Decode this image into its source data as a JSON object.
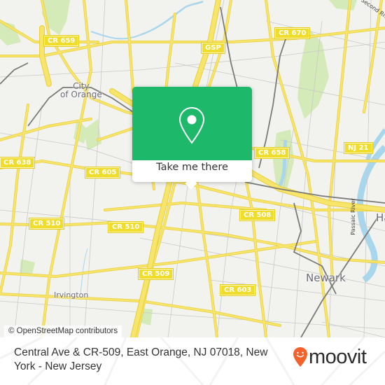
{
  "map": {
    "road_shields": [
      {
        "id": "cr659",
        "label": "CR 659"
      },
      {
        "id": "cr670",
        "label": "CR 670"
      },
      {
        "id": "gsp",
        "label": "GSP"
      },
      {
        "id": "cr638",
        "label": "CR 638"
      },
      {
        "id": "cr605",
        "label": "CR 605"
      },
      {
        "id": "cr658",
        "label": "CR 658"
      },
      {
        "id": "nj21",
        "label": "NJ 21"
      },
      {
        "id": "cr510a",
        "label": "CR 510"
      },
      {
        "id": "cr510b",
        "label": "CR 510"
      },
      {
        "id": "cr508",
        "label": "CR 508"
      },
      {
        "id": "cr509",
        "label": "CR 509"
      },
      {
        "id": "cr603",
        "label": "CR 603"
      }
    ],
    "places": {
      "city_of_orange_line1": "City",
      "city_of_orange_line2": "of Orange",
      "irvington": "Irvington",
      "newark": "Newark",
      "harrison_partial": "Ha"
    },
    "water_labels": {
      "second_river": "Second River",
      "passaic_river": "Passaic River"
    },
    "colors": {
      "land": "#f2f2ee",
      "road": "#f7e46a",
      "road_casing": "#e8cf3c",
      "minor_road": "#c9c9c9",
      "water": "#a8d6ec",
      "park": "#d4eab8",
      "rail": "#7a7a7a",
      "popup_green": "#1eb86a",
      "moovit_orange": "#f3622d"
    }
  },
  "popup": {
    "icon": "location-pin-icon",
    "button_label": "Take me there"
  },
  "attribution": "© OpenStreetMap contributors",
  "footer": {
    "address": "Central Ave & CR-509, East Orange, NJ 07018, New York - New Jersey",
    "logo_text": "moovit",
    "logo_icon": "moovit-smiley-pin-icon"
  }
}
